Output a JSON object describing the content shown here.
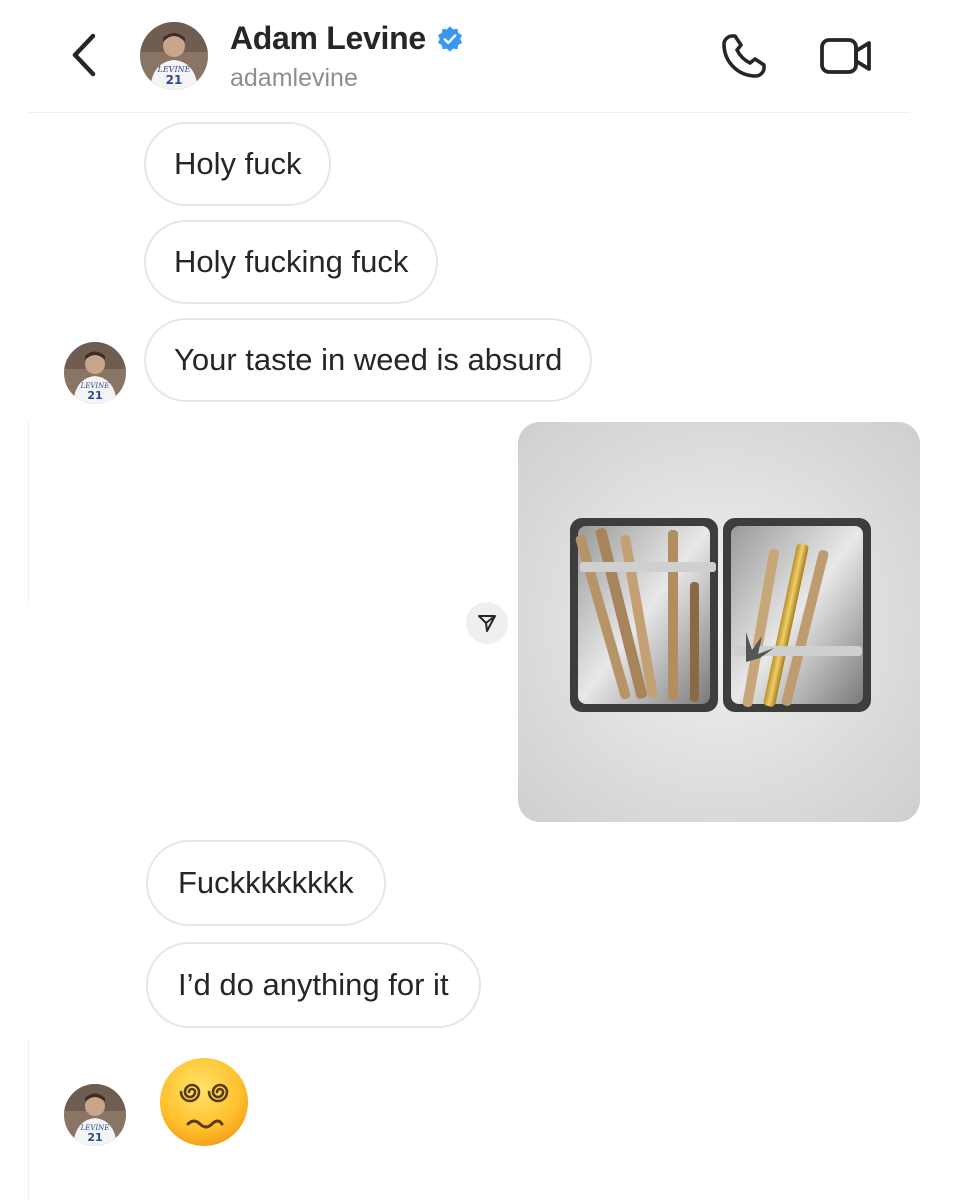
{
  "header": {
    "name": "Adam Levine",
    "handle": "adamlevine",
    "avatar_jersey_text": "LEVINE",
    "avatar_jersey_number": "21"
  },
  "icons": {
    "back": "chevron-left-icon",
    "verified": "verified-badge-icon",
    "call": "phone-icon",
    "video": "video-camera-icon",
    "share": "send-icon"
  },
  "colors": {
    "verified_blue": "#3897f0",
    "bubble_border": "#e6e6e6",
    "text": "#262626",
    "secondary_text": "#8e8e8e"
  },
  "messages": [
    {
      "type": "text",
      "text": "Holy fuck"
    },
    {
      "type": "text",
      "text": "Holy fucking fuck"
    },
    {
      "type": "text",
      "text": "Your taste in weed is absurd"
    },
    {
      "type": "image",
      "description_visible": false
    },
    {
      "type": "text",
      "text": "Fuckkkkkkkk"
    },
    {
      "type": "text",
      "text": "I’d do anything for it"
    },
    {
      "type": "emoji",
      "text": "😵‍💫"
    }
  ]
}
